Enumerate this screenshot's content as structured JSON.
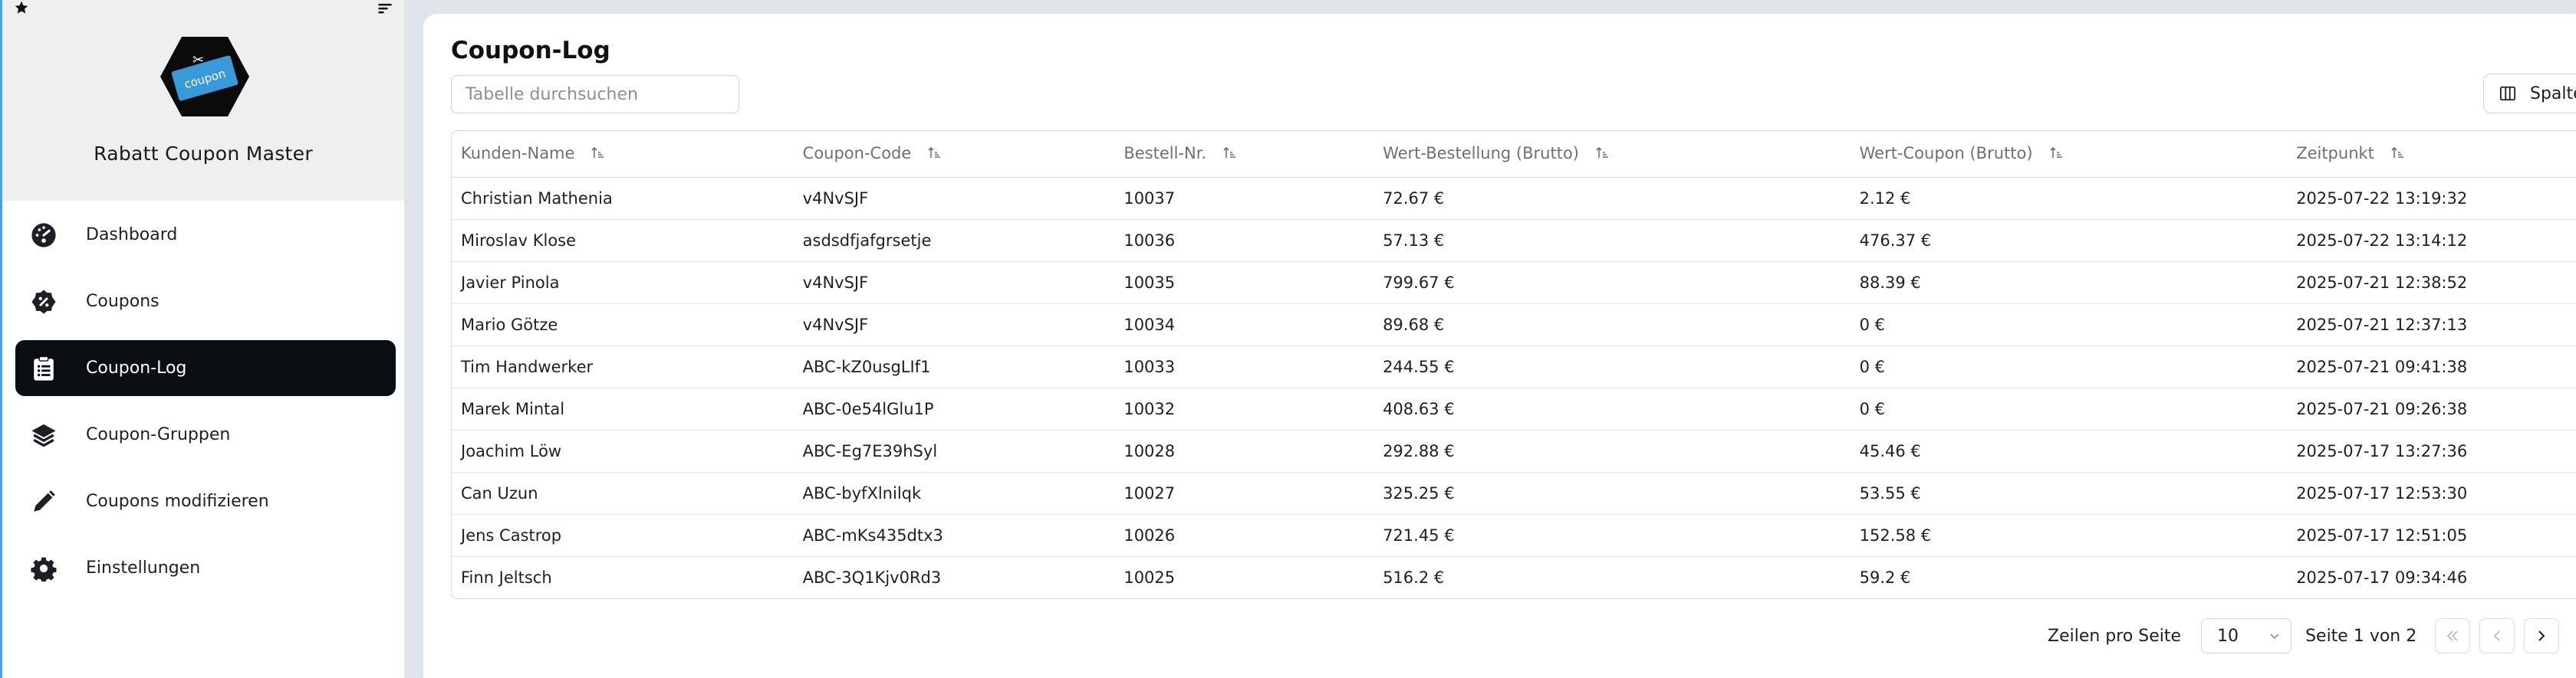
{
  "sidebar": {
    "app_title": "Rabatt Coupon Master",
    "logo_text": "coupon",
    "items": [
      {
        "label": "Dashboard",
        "icon": "gauge-icon"
      },
      {
        "label": "Coupons",
        "icon": "discount-badge-icon"
      },
      {
        "label": "Coupon-Log",
        "icon": "clipboard-list-icon",
        "active": true
      },
      {
        "label": "Coupon-Gruppen",
        "icon": "layers-icon"
      },
      {
        "label": "Coupons modifizieren",
        "icon": "pencil-icon"
      },
      {
        "label": "Einstellungen",
        "icon": "gear-icon"
      }
    ]
  },
  "main": {
    "title": "Coupon-Log",
    "search_placeholder": "Tabelle durchsuchen",
    "columns_button": "Spalten",
    "table": {
      "headers": [
        "Kunden-Name",
        "Coupon-Code",
        "Bestell-Nr.",
        "Wert-Bestellung (Brutto)",
        "Wert-Coupon (Brutto)",
        "Zeitpunkt"
      ],
      "rows": [
        [
          "Christian Mathenia",
          "v4NvSJF",
          "10037",
          "72.67 €",
          "2.12 €",
          "2025-07-22 13:19:32"
        ],
        [
          "Miroslav Klose",
          "asdsdfjafgrsetje",
          "10036",
          "57.13 €",
          "476.37 €",
          "2025-07-22 13:14:12"
        ],
        [
          "Javier Pinola",
          "v4NvSJF",
          "10035",
          "799.67 €",
          "88.39 €",
          "2025-07-21 12:38:52"
        ],
        [
          "Mario Götze",
          "v4NvSJF",
          "10034",
          "89.68 €",
          "0 €",
          "2025-07-21 12:37:13"
        ],
        [
          "Tim Handwerker",
          "ABC-kZ0usgLIf1",
          "10033",
          "244.55 €",
          "0 €",
          "2025-07-21 09:41:38"
        ],
        [
          "Marek Mintal",
          "ABC-0e54lGlu1P",
          "10032",
          "408.63 €",
          "0 €",
          "2025-07-21 09:26:38"
        ],
        [
          "Joachim Löw",
          "ABC-Eg7E39hSyl",
          "10028",
          "292.88 €",
          "45.46 €",
          "2025-07-17 13:27:36"
        ],
        [
          "Can Uzun",
          "ABC-byfXlnilqk",
          "10027",
          "325.25 €",
          "53.55 €",
          "2025-07-17 12:53:30"
        ],
        [
          "Jens Castrop",
          "ABC-mKs435dtx3",
          "10026",
          "721.45 €",
          "152.58 €",
          "2025-07-17 12:51:05"
        ],
        [
          "Finn Jeltsch",
          "ABC-3Q1Kjv0Rd3",
          "10025",
          "516.2 €",
          "59.2 €",
          "2025-07-17 09:34:46"
        ]
      ]
    },
    "pagination": {
      "rows_per_page_label": "Zeilen pro Seite",
      "rows_per_page_value": "10",
      "page_info": "Seite 1 von 2"
    }
  },
  "colors": {
    "active_nav_bg": "#0a0f14",
    "logo_hex": "#0b0b0b",
    "logo_ticket": "#3a9ad9",
    "background": "#dfe5ea"
  }
}
